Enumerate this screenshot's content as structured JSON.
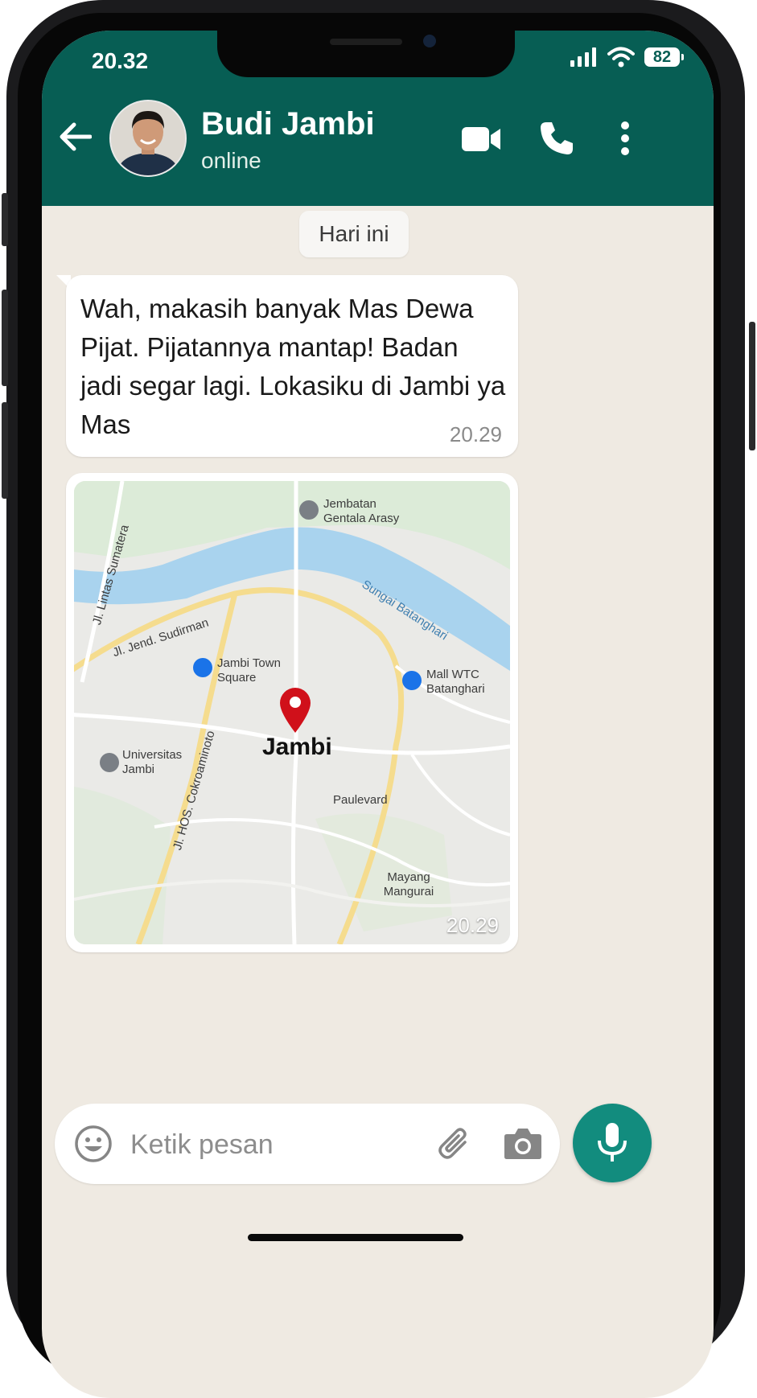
{
  "status_bar": {
    "time": "20.32",
    "battery": "82"
  },
  "chat_header": {
    "contact_name": "Budi Jambi",
    "contact_status": "online"
  },
  "date_divider": "Hari ini",
  "messages": [
    {
      "type": "text",
      "text": "Wah, makasih banyak Mas Dewa Pijat. Pijatannya mantap! Badan jadi segar lagi. Lokasiku di Jambi ya Mas",
      "time": "20.29"
    },
    {
      "type": "location",
      "time": "20.29",
      "map": {
        "pin_label": "Jambi",
        "places": {
          "bridge": "Jembatan Gentala Arasy",
          "river": "Sungai Batanghari",
          "street_1": "Jl. Lintas Sumatera",
          "street_2": "Jl. Jend. Sudirman",
          "street_3": "Jl. HOS. Cokroaminoto",
          "mall_1": "Jambi Town Square",
          "mall_2": "Mall WTC Batanghari",
          "university": "Universitas Jambi",
          "area_1": "Paulevard",
          "area_2": "Mayang Mangurai"
        }
      }
    }
  ],
  "composer": {
    "placeholder": "Ketik pesan"
  },
  "colors": {
    "header": "#075e54",
    "chat_background": "#efeae2",
    "mic_button": "#128c7e",
    "pin": "#d0101a",
    "river": "#a9d3ee"
  }
}
